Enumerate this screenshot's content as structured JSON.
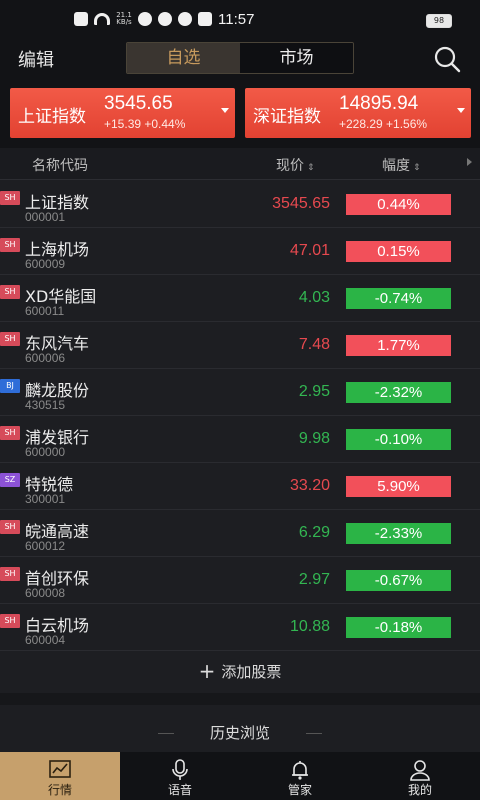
{
  "status_bar": {
    "time": "11:57",
    "net_speed": "21.1 KB/s",
    "battery": "98"
  },
  "topnav": {
    "edit_label": "编辑",
    "tabs": [
      "自选",
      "市场"
    ],
    "active_tab": "自选"
  },
  "indices": [
    {
      "name": "上证指数",
      "value": "3545.65",
      "change": "+15.39 +0.44%"
    },
    {
      "name": "深证指数",
      "value": "14895.94",
      "change": "+228.29 +1.56%"
    }
  ],
  "table_header": {
    "name": "名称代码",
    "price": "现价",
    "change": "幅度",
    "sort_icon": "⇕"
  },
  "stocks": [
    {
      "exchange": "SH",
      "name": "上证指数",
      "code": "000001",
      "price": "3545.65",
      "change": "0.44%",
      "dir": "up"
    },
    {
      "exchange": "SH",
      "name": "上海机场",
      "code": "600009",
      "price": "47.01",
      "change": "0.15%",
      "dir": "up"
    },
    {
      "exchange": "SH",
      "name": "XD华能国",
      "code": "600011",
      "price": "4.03",
      "change": "-0.74%",
      "dir": "down"
    },
    {
      "exchange": "SH",
      "name": "东风汽车",
      "code": "600006",
      "price": "7.48",
      "change": "1.77%",
      "dir": "up"
    },
    {
      "exchange": "BJ",
      "name": "麟龙股份",
      "code": "430515",
      "price": "2.95",
      "change": "-2.32%",
      "dir": "down"
    },
    {
      "exchange": "SH",
      "name": "浦发银行",
      "code": "600000",
      "price": "9.98",
      "change": "-0.10%",
      "dir": "down"
    },
    {
      "exchange": "SZ",
      "name": "特锐德",
      "code": "300001",
      "price": "33.20",
      "change": "5.90%",
      "dir": "up"
    },
    {
      "exchange": "SH",
      "name": "皖通高速",
      "code": "600012",
      "price": "6.29",
      "change": "-2.33%",
      "dir": "down"
    },
    {
      "exchange": "SH",
      "name": "首创环保",
      "code": "600008",
      "price": "2.97",
      "change": "-0.67%",
      "dir": "down"
    },
    {
      "exchange": "SH",
      "name": "白云机场",
      "code": "600004",
      "price": "10.88",
      "change": "-0.18%",
      "dir": "down"
    }
  ],
  "add_stock_label": "添加股票",
  "history_title": "历史浏览",
  "tabbar": [
    {
      "label": "行情",
      "icon": "chart-icon",
      "active": true
    },
    {
      "label": "语音",
      "icon": "microphone-icon",
      "active": false
    },
    {
      "label": "管家",
      "icon": "bell-icon",
      "active": false
    },
    {
      "label": "我的",
      "icon": "person-icon",
      "active": false
    }
  ],
  "colors": {
    "up": "#e6494f",
    "down": "#33b652",
    "accent": "#c6a06c"
  }
}
